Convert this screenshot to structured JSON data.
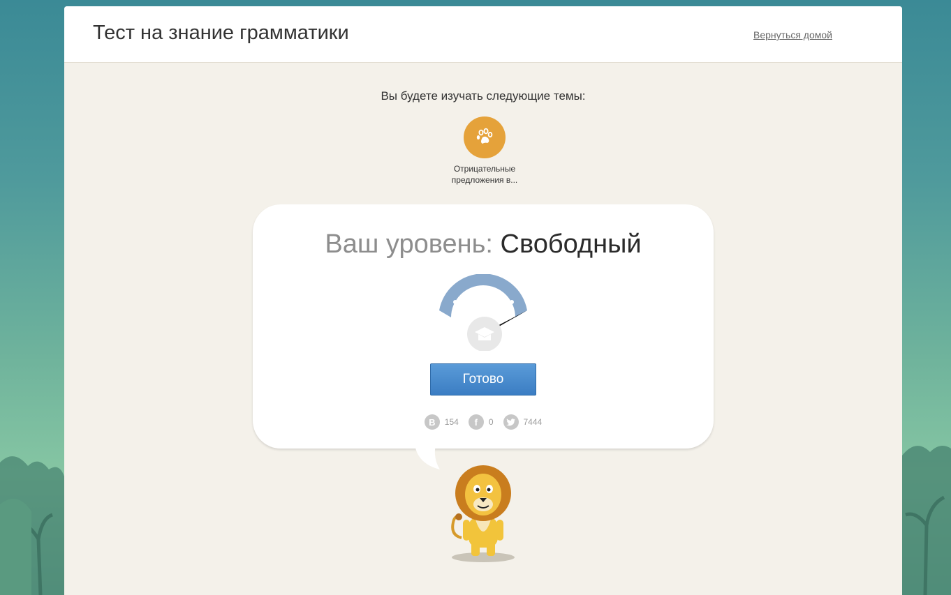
{
  "header": {
    "title": "Тест на знание грамматики",
    "home_link": "Вернуться домой"
  },
  "topics_intro": "Вы будете изучать следующие темы:",
  "topics": [
    {
      "label": "Отрицательные предложения в...",
      "icon": "paw-icon"
    }
  ],
  "result": {
    "level_label": "Ваш уровень:",
    "level_value": "Свободный",
    "gauge_level": "3 of 3",
    "done_button": "Готово"
  },
  "shares": [
    {
      "network": "vk",
      "icon": "vk-icon",
      "count": "154"
    },
    {
      "network": "facebook",
      "icon": "facebook-icon",
      "count": "0"
    },
    {
      "network": "twitter",
      "icon": "twitter-icon",
      "count": "7444"
    }
  ],
  "colors": {
    "topic_accent": "#e5a23a",
    "button": "#4a8bcc",
    "gauge": "#89a9cc"
  }
}
